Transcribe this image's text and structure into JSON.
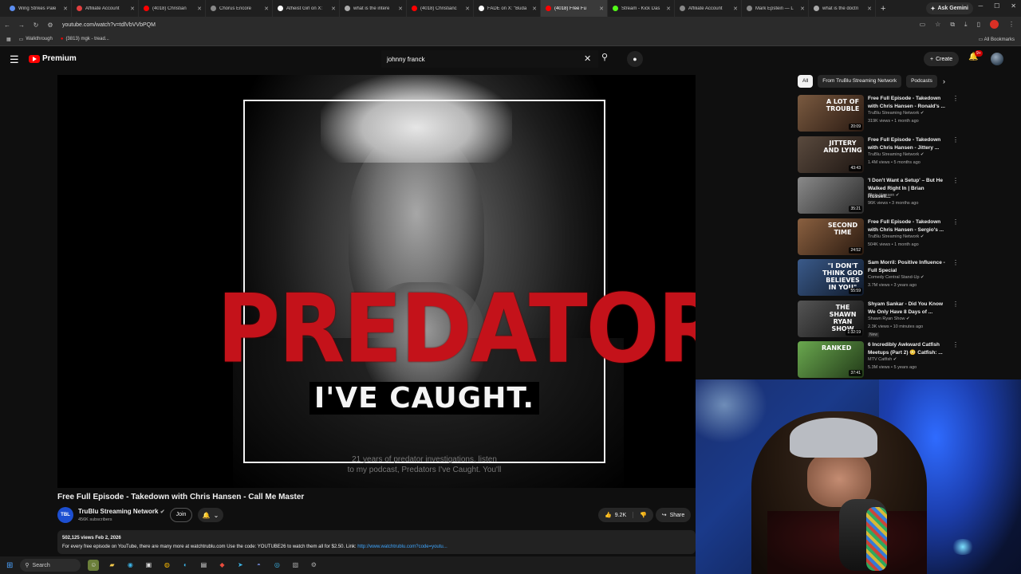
{
  "browser": {
    "tabs": [
      {
        "label": "Wing Strikes Pale",
        "color": "#5b8def"
      },
      {
        "label": "Affiliate Account",
        "color": "#e23f3f"
      },
      {
        "label": "(4018) Christian",
        "color": "#ff0000"
      },
      {
        "label": "Chorus Encore",
        "color": "#888888"
      },
      {
        "label": "Atheist Girl on X:",
        "color": "#ffffff"
      },
      {
        "label": "what is the intere",
        "color": "#aaaaaa"
      },
      {
        "label": "(4018) Christianc",
        "color": "#ff0000"
      },
      {
        "label": "FADE on X: \"Buda",
        "color": "#ffffff"
      },
      {
        "label": "(4018) Free Fu",
        "color": "#ff0000",
        "active": true
      },
      {
        "label": "Stream - Kick Das",
        "color": "#53fc18"
      },
      {
        "label": "Affiliate Account",
        "color": "#888888"
      },
      {
        "label": "Mark Epstein — L",
        "color": "#888888"
      },
      {
        "label": "what is the doctri",
        "color": "#aaaaaa"
      }
    ],
    "new_tab": "+",
    "ask_gemini": "Ask Gemini",
    "url": "youtube.com/watch?v=tdlVbVVbPQM",
    "bookmarks": [
      {
        "label": "Walkthrough"
      },
      {
        "label": "(3813) mgk - tread..."
      }
    ],
    "all_bookmarks": "All Bookmarks"
  },
  "youtube": {
    "logo_text": "Premium",
    "search_value": "johnny franck",
    "create_label": "Create",
    "notifications_badge": "9+"
  },
  "video": {
    "overlay_title": "PREDATORS",
    "overlay_subtitle": "I'VE CAUGHT.",
    "caption_line1": "21 years of predator investigations, listen",
    "caption_line2": "to my podcast, Predators I've Caught. You'll",
    "title": "Free Full Episode - Takedown with Chris Hansen - Call Me Master",
    "channel": "TruBlu Streaming Network",
    "channel_logo_text": "TBL",
    "subscribers": "456K subscribers",
    "join_label": "Join",
    "likes": "9.2K",
    "share_label": "Share",
    "views_date": "502,125 views  Feb 2, 2026",
    "description": "For every free episode on YouTube, there are many more at watchtrublu.com  Use the code: YOUTUBE26 to watch them all for $2.50.  Link: ",
    "description_link": "http://www.watchtrublu.com?code=youtu..."
  },
  "sidebar": {
    "chips": [
      "All",
      "From TruBlu Streaming Network",
      "Podcasts"
    ],
    "recommendations": [
      {
        "title": "Free Full Episode - Takedown with Chris Hansen - Ronald's ...",
        "channel": "TruBlu Streaming Network",
        "meta": "319K views • 1 month ago",
        "duration": "20:09",
        "thumb_text": "A LOT OF TROUBLE",
        "thumb_colors": [
          "#7a5a40",
          "#2a1a12"
        ]
      },
      {
        "title": "Free Full Episode - Takedown with Chris Hansen - Jittery ...",
        "channel": "TruBlu Streaming Network",
        "meta": "1.4M views • 5 months ago",
        "duration": "43:43",
        "thumb_text": "JITTERY AND LYING",
        "thumb_colors": [
          "#5a4a3e",
          "#1e1612"
        ]
      },
      {
        "title": "'I Don't Want a Setup' – But He Walked Right In | Brian Russell...",
        "channel": "Chris Hansen",
        "meta": "96K views • 3 months ago",
        "duration": "35:21",
        "thumb_text": "",
        "thumb_colors": [
          "#8a8a8a",
          "#2a2a2a"
        ]
      },
      {
        "title": "Free Full Episode - Takedown with Chris Hansen - Sergio's ...",
        "channel": "TruBlu Streaming Network",
        "meta": "504K views • 1 month ago",
        "duration": "24:52",
        "thumb_text": "SECOND TIME",
        "thumb_colors": [
          "#8a6040",
          "#2a1a10"
        ]
      },
      {
        "title": "Sam Morril: Positive Influence - Full Special",
        "channel": "Comedy Central Stand-Up",
        "meta": "3.7M views • 3 years ago",
        "duration": "55:59",
        "thumb_text": "\"I DON'T THINK GOD BELIEVES IN YOU\"",
        "thumb_colors": [
          "#3a5a8a",
          "#101a2a"
        ]
      },
      {
        "title": "Shyam Sankar - Did You Know We Only Have 8 Days of ...",
        "channel": "Shawn Ryan Show",
        "meta": "2.3K views • 10 minutes ago",
        "duration": "1:32:19",
        "thumb_text": "THE SHAWN RYAN SHOW",
        "thumb_colors": [
          "#555555",
          "#111111"
        ],
        "badge": "New"
      },
      {
        "title": "6 Incredibly Awkward Catfish Meetups (Part 2) 😳 Catfish: ...",
        "channel": "MTV Catfish",
        "meta": "5.3M views • 5 years ago",
        "duration": "37:41",
        "thumb_text": "RANKED",
        "thumb_colors": [
          "#6aa84f",
          "#223a18"
        ]
      }
    ]
  },
  "taskbar": {
    "search_label": "Search"
  },
  "colors": {
    "yt_red": "#ff0000",
    "predators_red": "#c4121a",
    "link_blue": "#3ea6ff",
    "background": "#0f0f0f"
  }
}
